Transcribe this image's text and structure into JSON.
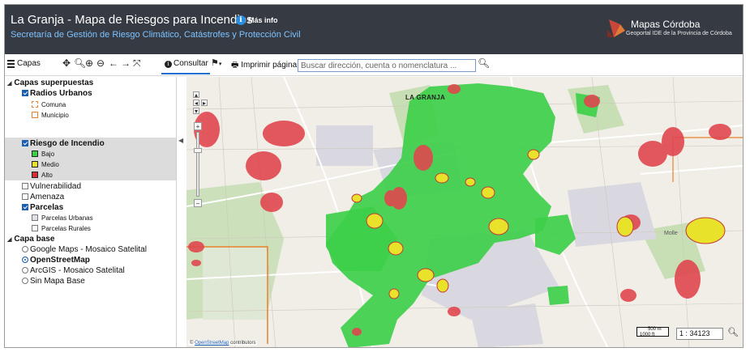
{
  "header": {
    "title": "La Granja - Mapa de Riesgos para Incendios",
    "info_link": "Más info",
    "subtitle": "Secretaría de Gestión de Riesgo Climático, Catástrofes y Protección Civil",
    "brand_name": "Mapas Córdoba",
    "brand_sub": "Geoportal IDE de la Provincia de Córdoba"
  },
  "toolbar": {
    "layers_label": "Capas",
    "consult_label": "Consultar",
    "print_label": "Imprimir página",
    "search_placeholder": "Buscar dirección, cuenta o nomenclatura ...",
    "icons": [
      "menu-icon",
      "pan-icon",
      "zoom-icon",
      "zoom-in-icon",
      "zoom-out-icon",
      "back-arrow-icon",
      "forward-arrow-icon",
      "fullscreen-icon",
      "info-icon",
      "flag-icon",
      "print-icon",
      "search-icon"
    ]
  },
  "panel": {
    "overlays_header": "Capas superpuestas",
    "radios_urbanos": {
      "label": "Radios Urbanos",
      "checked": true,
      "items": [
        "Comuna",
        "Municipio"
      ]
    },
    "riesgo": {
      "label": "Riesgo de Incendio",
      "checked": true,
      "items": [
        "Bajo",
        "Medio",
        "Alto"
      ]
    },
    "vulnerabilidad": "Vulnerabilidad",
    "amenaza": "Amenaza",
    "parcelas": {
      "label": "Parcelas",
      "checked": true,
      "items": [
        "Parcelas Urbanas",
        "Parcelas Rurales"
      ]
    },
    "base_header": "Capa base",
    "base_options": [
      "Google Maps - Mosaico Satelital",
      "OpenStreetMap",
      "ArcGIS - Mosaico Satelital",
      "Sin Mapa Base"
    ],
    "base_selected": "OpenStreetMap"
  },
  "map": {
    "place_label": "LA GRANJA",
    "place_label2": "Molle",
    "scale_top": "500 m",
    "scale_bottom": "1000 ft",
    "scale_value": "1 : 34123",
    "attribution_prefix": "©",
    "attribution_link": "OpenStreetMap",
    "attribution_suffix": "contributors"
  },
  "colors": {
    "header_bg": "#353a43",
    "subtitle": "#7ec3ff",
    "risk_low": "#3ecf4a",
    "risk_medium": "#e8e22a",
    "risk_high": "#e0474f",
    "comuna": "#e8812a",
    "municipio": "#e8812a",
    "accent": "#1a5fb4"
  }
}
